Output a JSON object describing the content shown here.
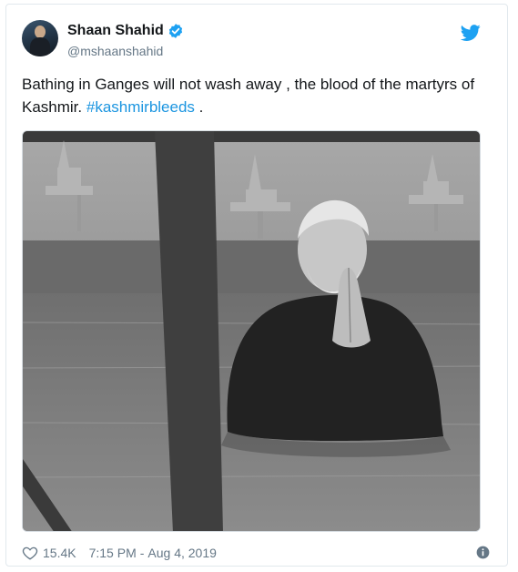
{
  "tweet": {
    "author": {
      "display_name": "Shaan Shahid",
      "handle": "@mshaanshahid",
      "verified": true,
      "avatar_icon": "profile-photo"
    },
    "text_before_hashtag": "Bathing in Ganges will not wash away , the blood of the martyrs of Kashmir. ",
    "hashtag": "#kashmirbleeds",
    "text_after_hashtag": " .",
    "likes": "15.4K",
    "time": "7:15 PM",
    "separator": "-",
    "date": "Aug 4, 2019"
  },
  "colors": {
    "link": "#1b95e0",
    "secondary_text": "#657786",
    "border": "#e1e8ed",
    "brand_blue": "#1da1f2"
  },
  "icons": {
    "brand": "twitter-bird-icon",
    "verified": "verified-badge-icon",
    "like": "heart-icon",
    "info": "info-icon"
  }
}
